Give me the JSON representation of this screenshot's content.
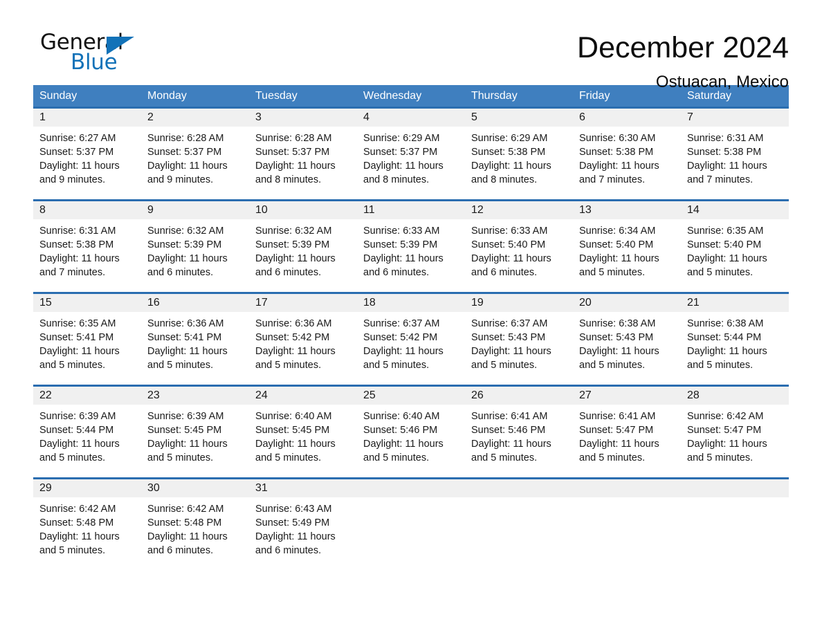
{
  "brand": {
    "name_top": "General",
    "name_bottom": "Blue",
    "accent_color": "#1272b8"
  },
  "header": {
    "title": "December 2024",
    "location": "Ostuacan, Mexico"
  },
  "calendar": {
    "header_color": "#3f7fbf",
    "row_divider_color": "#2a6db0",
    "daynum_band_color": "#f0f0f0",
    "weekdays": [
      "Sunday",
      "Monday",
      "Tuesday",
      "Wednesday",
      "Thursday",
      "Friday",
      "Saturday"
    ],
    "weeks": [
      [
        {
          "day": "1",
          "sunrise": "Sunrise: 6:27 AM",
          "sunset": "Sunset: 5:37 PM",
          "daylight": "Daylight: 11 hours and 9 minutes."
        },
        {
          "day": "2",
          "sunrise": "Sunrise: 6:28 AM",
          "sunset": "Sunset: 5:37 PM",
          "daylight": "Daylight: 11 hours and 9 minutes."
        },
        {
          "day": "3",
          "sunrise": "Sunrise: 6:28 AM",
          "sunset": "Sunset: 5:37 PM",
          "daylight": "Daylight: 11 hours and 8 minutes."
        },
        {
          "day": "4",
          "sunrise": "Sunrise: 6:29 AM",
          "sunset": "Sunset: 5:37 PM",
          "daylight": "Daylight: 11 hours and 8 minutes."
        },
        {
          "day": "5",
          "sunrise": "Sunrise: 6:29 AM",
          "sunset": "Sunset: 5:38 PM",
          "daylight": "Daylight: 11 hours and 8 minutes."
        },
        {
          "day": "6",
          "sunrise": "Sunrise: 6:30 AM",
          "sunset": "Sunset: 5:38 PM",
          "daylight": "Daylight: 11 hours and 7 minutes."
        },
        {
          "day": "7",
          "sunrise": "Sunrise: 6:31 AM",
          "sunset": "Sunset: 5:38 PM",
          "daylight": "Daylight: 11 hours and 7 minutes."
        }
      ],
      [
        {
          "day": "8",
          "sunrise": "Sunrise: 6:31 AM",
          "sunset": "Sunset: 5:38 PM",
          "daylight": "Daylight: 11 hours and 7 minutes."
        },
        {
          "day": "9",
          "sunrise": "Sunrise: 6:32 AM",
          "sunset": "Sunset: 5:39 PM",
          "daylight": "Daylight: 11 hours and 6 minutes."
        },
        {
          "day": "10",
          "sunrise": "Sunrise: 6:32 AM",
          "sunset": "Sunset: 5:39 PM",
          "daylight": "Daylight: 11 hours and 6 minutes."
        },
        {
          "day": "11",
          "sunrise": "Sunrise: 6:33 AM",
          "sunset": "Sunset: 5:39 PM",
          "daylight": "Daylight: 11 hours and 6 minutes."
        },
        {
          "day": "12",
          "sunrise": "Sunrise: 6:33 AM",
          "sunset": "Sunset: 5:40 PM",
          "daylight": "Daylight: 11 hours and 6 minutes."
        },
        {
          "day": "13",
          "sunrise": "Sunrise: 6:34 AM",
          "sunset": "Sunset: 5:40 PM",
          "daylight": "Daylight: 11 hours and 5 minutes."
        },
        {
          "day": "14",
          "sunrise": "Sunrise: 6:35 AM",
          "sunset": "Sunset: 5:40 PM",
          "daylight": "Daylight: 11 hours and 5 minutes."
        }
      ],
      [
        {
          "day": "15",
          "sunrise": "Sunrise: 6:35 AM",
          "sunset": "Sunset: 5:41 PM",
          "daylight": "Daylight: 11 hours and 5 minutes."
        },
        {
          "day": "16",
          "sunrise": "Sunrise: 6:36 AM",
          "sunset": "Sunset: 5:41 PM",
          "daylight": "Daylight: 11 hours and 5 minutes."
        },
        {
          "day": "17",
          "sunrise": "Sunrise: 6:36 AM",
          "sunset": "Sunset: 5:42 PM",
          "daylight": "Daylight: 11 hours and 5 minutes."
        },
        {
          "day": "18",
          "sunrise": "Sunrise: 6:37 AM",
          "sunset": "Sunset: 5:42 PM",
          "daylight": "Daylight: 11 hours and 5 minutes."
        },
        {
          "day": "19",
          "sunrise": "Sunrise: 6:37 AM",
          "sunset": "Sunset: 5:43 PM",
          "daylight": "Daylight: 11 hours and 5 minutes."
        },
        {
          "day": "20",
          "sunrise": "Sunrise: 6:38 AM",
          "sunset": "Sunset: 5:43 PM",
          "daylight": "Daylight: 11 hours and 5 minutes."
        },
        {
          "day": "21",
          "sunrise": "Sunrise: 6:38 AM",
          "sunset": "Sunset: 5:44 PM",
          "daylight": "Daylight: 11 hours and 5 minutes."
        }
      ],
      [
        {
          "day": "22",
          "sunrise": "Sunrise: 6:39 AM",
          "sunset": "Sunset: 5:44 PM",
          "daylight": "Daylight: 11 hours and 5 minutes."
        },
        {
          "day": "23",
          "sunrise": "Sunrise: 6:39 AM",
          "sunset": "Sunset: 5:45 PM",
          "daylight": "Daylight: 11 hours and 5 minutes."
        },
        {
          "day": "24",
          "sunrise": "Sunrise: 6:40 AM",
          "sunset": "Sunset: 5:45 PM",
          "daylight": "Daylight: 11 hours and 5 minutes."
        },
        {
          "day": "25",
          "sunrise": "Sunrise: 6:40 AM",
          "sunset": "Sunset: 5:46 PM",
          "daylight": "Daylight: 11 hours and 5 minutes."
        },
        {
          "day": "26",
          "sunrise": "Sunrise: 6:41 AM",
          "sunset": "Sunset: 5:46 PM",
          "daylight": "Daylight: 11 hours and 5 minutes."
        },
        {
          "day": "27",
          "sunrise": "Sunrise: 6:41 AM",
          "sunset": "Sunset: 5:47 PM",
          "daylight": "Daylight: 11 hours and 5 minutes."
        },
        {
          "day": "28",
          "sunrise": "Sunrise: 6:42 AM",
          "sunset": "Sunset: 5:47 PM",
          "daylight": "Daylight: 11 hours and 5 minutes."
        }
      ],
      [
        {
          "day": "29",
          "sunrise": "Sunrise: 6:42 AM",
          "sunset": "Sunset: 5:48 PM",
          "daylight": "Daylight: 11 hours and 5 minutes."
        },
        {
          "day": "30",
          "sunrise": "Sunrise: 6:42 AM",
          "sunset": "Sunset: 5:48 PM",
          "daylight": "Daylight: 11 hours and 6 minutes."
        },
        {
          "day": "31",
          "sunrise": "Sunrise: 6:43 AM",
          "sunset": "Sunset: 5:49 PM",
          "daylight": "Daylight: 11 hours and 6 minutes."
        },
        {
          "day": "",
          "sunrise": "",
          "sunset": "",
          "daylight": ""
        },
        {
          "day": "",
          "sunrise": "",
          "sunset": "",
          "daylight": ""
        },
        {
          "day": "",
          "sunrise": "",
          "sunset": "",
          "daylight": ""
        },
        {
          "day": "",
          "sunrise": "",
          "sunset": "",
          "daylight": ""
        }
      ]
    ]
  }
}
